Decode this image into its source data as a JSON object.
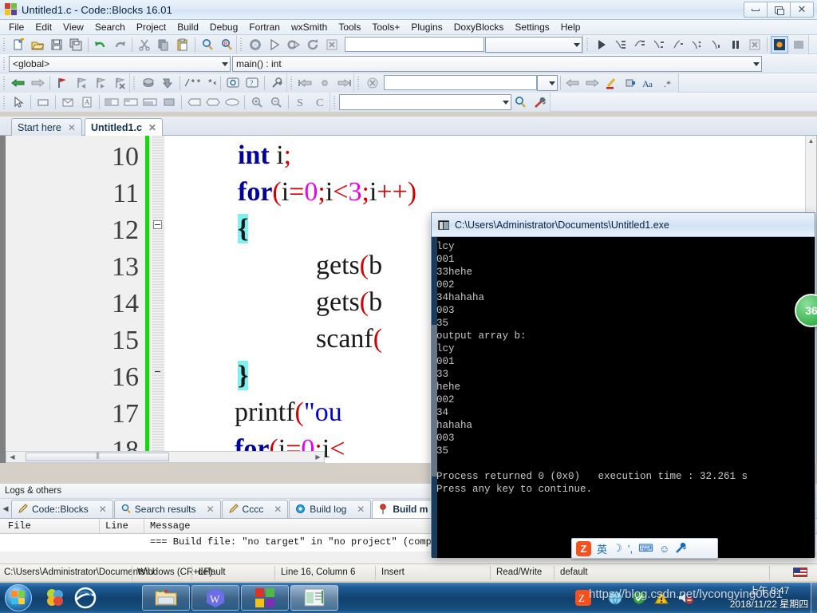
{
  "window": {
    "title": "Untitled1.c - Code::Blocks 16.01",
    "icon": "codeblocks-icon",
    "buttons": [
      {
        "name": "minimize-button",
        "glyph": "minimize"
      },
      {
        "name": "restore-button",
        "glyph": "restore"
      },
      {
        "name": "close-button",
        "glyph": "✕"
      }
    ]
  },
  "menubar": {
    "items": [
      "File",
      "Edit",
      "View",
      "Search",
      "Project",
      "Build",
      "Debug",
      "Fortran",
      "wxSmith",
      "Tools",
      "Tools+",
      "Plugins",
      "DoxyBlocks",
      "Settings",
      "Help"
    ]
  },
  "toolbars": {
    "row2": {
      "scope_combo_value": "<global>",
      "function_combo_value": "main() : int"
    },
    "row1_search_value": "",
    "row3_goto_value": "",
    "row4_search_value": ""
  },
  "editor_tabs": [
    {
      "label": "Start here",
      "active": false,
      "close": "✕"
    },
    {
      "label": "Untitled1.c",
      "active": true,
      "close": "✕"
    }
  ],
  "code": {
    "line_numbers": [
      "10",
      "11",
      "12",
      "13",
      "14",
      "15",
      "16",
      "17",
      "18"
    ],
    "lines": [
      {
        "number": "10",
        "tokens": [
          {
            "t": "int",
            "c": "kw"
          },
          {
            "t": " i",
            "c": "id"
          },
          {
            "t": ";",
            "c": "op"
          }
        ]
      },
      {
        "number": "11",
        "tokens": [
          {
            "t": "for",
            "c": "kw"
          },
          {
            "t": "(",
            "c": "op"
          },
          {
            "t": "i",
            "c": "id"
          },
          {
            "t": "=",
            "c": "op"
          },
          {
            "t": "0",
            "c": "num"
          },
          {
            "t": ";",
            "c": "op"
          },
          {
            "t": "i",
            "c": "id"
          },
          {
            "t": "<",
            "c": "op"
          },
          {
            "t": "3",
            "c": "num"
          },
          {
            "t": ";",
            "c": "op"
          },
          {
            "t": "i",
            "c": "id"
          },
          {
            "t": "++",
            "c": "op"
          },
          {
            "t": ")",
            "c": "op"
          }
        ]
      },
      {
        "number": "12",
        "tokens": [
          {
            "t": "{",
            "c": "hl"
          }
        ]
      },
      {
        "number": "13",
        "tokens": [
          {
            "t": "    gets",
            "c": "id"
          },
          {
            "t": "(b",
            "c": "op"
          }
        ]
      },
      {
        "number": "14",
        "tokens": [
          {
            "t": "    gets",
            "c": "id"
          },
          {
            "t": "(b",
            "c": "op"
          }
        ]
      },
      {
        "number": "15",
        "tokens": [
          {
            "t": "    scanf",
            "c": "id"
          },
          {
            "t": "(",
            "c": "op"
          }
        ]
      },
      {
        "number": "16",
        "tokens": [
          {
            "t": "}",
            "c": "hl"
          }
        ]
      },
      {
        "number": "17",
        "tokens": [
          {
            "t": "printf",
            "c": "id"
          },
          {
            "t": "(",
            "c": "op"
          },
          {
            "t": "\"ou",
            "c": "str"
          }
        ]
      },
      {
        "number": "18",
        "tokens": [
          {
            "t": "for",
            "c": "kw"
          },
          {
            "t": "(",
            "c": "op"
          },
          {
            "t": "i",
            "c": "id"
          },
          {
            "t": "=",
            "c": "op"
          },
          {
            "t": "0",
            "c": "num"
          },
          {
            "t": ";",
            "c": "op"
          },
          {
            "t": "i",
            "c": "id"
          },
          {
            "t": "<",
            "c": "op"
          }
        ]
      }
    ]
  },
  "logs": {
    "panel_title": "Logs & others",
    "tabs": [
      {
        "label": "Code::Blocks",
        "icon": "pencil-icon",
        "active": false
      },
      {
        "label": "Search results",
        "icon": "magnifier-icon",
        "active": false
      },
      {
        "label": "Cccc",
        "icon": "pencil-icon",
        "active": false
      },
      {
        "label": "Build log",
        "icon": "gear-blue-icon",
        "active": false
      },
      {
        "label": "Build m",
        "icon": "pin-icon",
        "active": true
      }
    ],
    "columns": [
      "File",
      "Line",
      "Message"
    ],
    "rows": [
      {
        "file": "",
        "line": "",
        "message": "=== Build file: \"no target\" in \"no project\" (compil"
      }
    ]
  },
  "statusbar": {
    "path": "C:\\Users\\Administrator\\Documents\\U",
    "eol": "Windows (CR+LF)",
    "encoding": "default",
    "caret": "Line 16, Column 6",
    "mode": "Insert",
    "access": "Read/Write",
    "profile": "default",
    "keyboard_icon": "us-flag-icon"
  },
  "console": {
    "title": "C:\\Users\\Administrator\\Documents\\Untitled1.exe",
    "icon": "console-icon",
    "output": "lcy\n001\n33hehe\n002\n34hahaha\n003\n35\noutput array b:\nlcy\n001\n33\nhehe\n002\n34\nhahaha\n003\n35\n\nProcess returned 0 (0x0)   execution time : 32.261 s\nPress any key to continue."
  },
  "badge": {
    "label": "36"
  },
  "ime": {
    "logo": "Z",
    "items": [
      "英",
      "☽",
      "’,",
      "⌨",
      "☺",
      "🔧"
    ]
  },
  "taskbar": {
    "start": "start-orb",
    "quicklaunch": [
      {
        "name": "media-player-icon"
      },
      {
        "name": "internet-explorer-icon"
      }
    ],
    "apps": [
      {
        "name": "file-explorer-icon"
      },
      {
        "name": "wps-office-icon"
      },
      {
        "name": "windows-app-icon"
      },
      {
        "name": "codeblocks-app-icon"
      }
    ],
    "tray": [
      {
        "name": "ime-tray-icon"
      },
      {
        "name": "network-icon"
      },
      {
        "name": "shield-icon"
      },
      {
        "name": "warning-icon"
      },
      {
        "name": "volume-muted-icon"
      }
    ],
    "clock_time": "上午 8:47",
    "clock_date": "2018/11/22 星期四"
  },
  "watermark": {
    "text": "https://blog.csdn.net/lycongying0601"
  },
  "colors": {
    "accent_blue": "#1f5c96",
    "green_margin": "#0be000",
    "highlight_cyan": "#7ff0f0",
    "keyword_blue": "#00009e",
    "operator_red": "#d40000",
    "number_magenta": "#ee00ee",
    "string_blue": "#0000d0",
    "badge_green": "#3cb14f"
  }
}
